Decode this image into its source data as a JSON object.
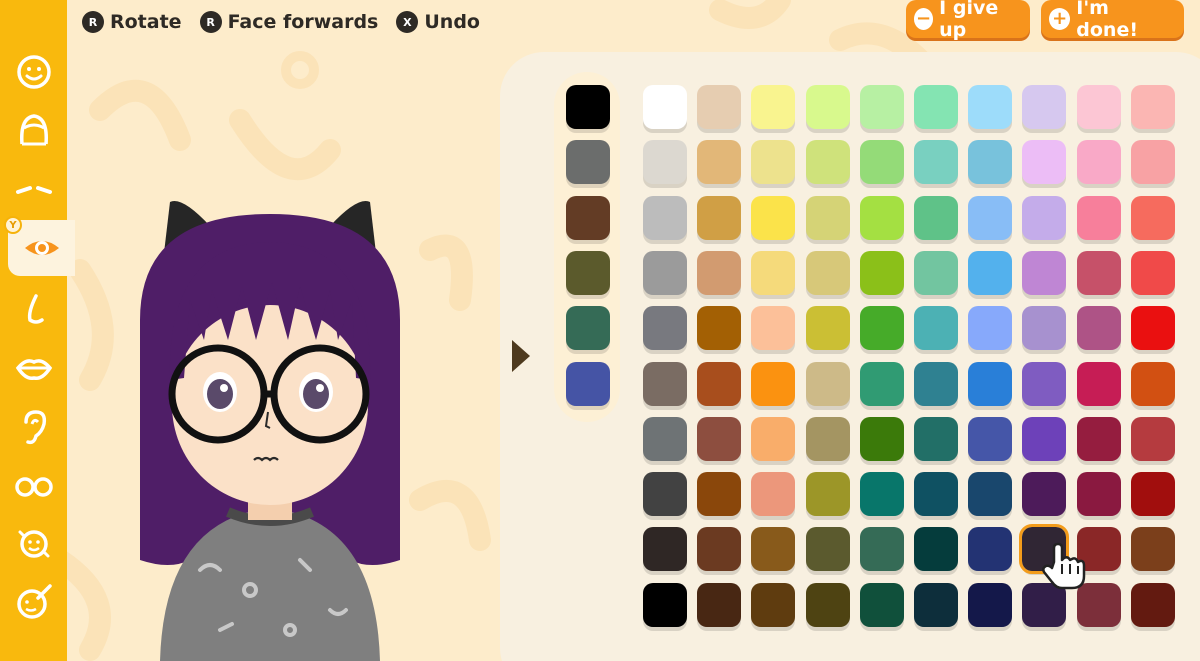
{
  "hints": [
    {
      "glyph": "R",
      "label": "Rotate",
      "icon": "stick-icon"
    },
    {
      "glyph": "R",
      "label": "Face forwards",
      "icon": "stick-press-icon"
    },
    {
      "glyph": "X",
      "label": "Undo",
      "icon": "x-button-icon"
    }
  ],
  "actions": {
    "give_up": {
      "label": "I give up",
      "icon": "minus-icon"
    },
    "done": {
      "label": "I'm done!",
      "icon": "plus-icon"
    }
  },
  "sidebar": {
    "items": [
      {
        "name": "face-shape",
        "icon": "face-icon"
      },
      {
        "name": "hair",
        "icon": "hair-icon"
      },
      {
        "name": "eyebrows",
        "icon": "eyebrows-icon"
      },
      {
        "name": "eyes",
        "icon": "eye-icon",
        "active": true
      },
      {
        "name": "nose",
        "icon": "nose-icon"
      },
      {
        "name": "mouth",
        "icon": "lips-icon"
      },
      {
        "name": "ears",
        "icon": "ear-icon"
      },
      {
        "name": "glasses",
        "icon": "glasses-icon"
      },
      {
        "name": "face-rotate",
        "icon": "face-rotate-icon"
      },
      {
        "name": "makeup",
        "icon": "face-brush-icon"
      }
    ]
  },
  "palette": {
    "base_colors": [
      "#000000",
      "#6b6d6c",
      "#633c25",
      "#5b5a2c",
      "#356b56",
      "#4554a5"
    ],
    "grid": [
      [
        "#ffffff",
        "#e6cdb1",
        "#f9f48f",
        "#d8f98d",
        "#b7f0a3",
        "#84e4b2",
        "#9ddcfa",
        "#d6c8ef",
        "#fcc6d4",
        "#fbb6b3"
      ],
      [
        "#dcd8d0",
        "#e2b778",
        "#ede28d",
        "#cfe27b",
        "#94db78",
        "#79d0c0",
        "#78c2dc",
        "#ecbdf6",
        "#f9a9c7",
        "#f8a2a4"
      ],
      [
        "#bcbcbc",
        "#d09f45",
        "#fbe34a",
        "#d5d376",
        "#a4e042",
        "#5fc288",
        "#88bdf6",
        "#c4acea",
        "#f77f9b",
        "#f66b5e"
      ],
      [
        "#9b9b9b",
        "#d29b70",
        "#f5da7b",
        "#d7c879",
        "#8bc019",
        "#72c5a0",
        "#53b1ed",
        "#bf86d4",
        "#c65169",
        "#f04a49"
      ],
      [
        "#78797f",
        "#a36004",
        "#fcc099",
        "#cbbf34",
        "#46ab29",
        "#4cb1b4",
        "#87a9fb",
        "#a791cf",
        "#ae5386",
        "#ea1010"
      ],
      [
        "#7a6c63",
        "#a84e1d",
        "#fb9210",
        "#cdba88",
        "#309b73",
        "#2f8191",
        "#297fd8",
        "#7f5cc1",
        "#c61d55",
        "#d25012"
      ],
      [
        "#6e7375",
        "#8d4e3f",
        "#f9ad6a",
        "#a49562",
        "#3b7a0a",
        "#226f67",
        "#4556a8",
        "#6d41b9",
        "#951d3f",
        "#b53b3f"
      ],
      [
        "#424242",
        "#8a470b",
        "#ec977b",
        "#9c9628",
        "#08766a",
        "#0f5162",
        "#19476d",
        "#4d1b5a",
        "#8a1940",
        "#a10e0d"
      ],
      [
        "#2f2725",
        "#6b3a21",
        "#885a1b",
        "#5b5a2e",
        "#356b56",
        "#053c3c",
        "#233373",
        "#302634",
        "#8a2727",
        "#7b3f1b"
      ],
      [
        "#000000",
        "#482713",
        "#5f3c0f",
        "#4e4312",
        "#10503b",
        "#0d2e3b",
        "#14184a",
        "#311e48",
        "#7c2f3a",
        "#631a10"
      ]
    ],
    "selected": {
      "row": 8,
      "col": 7
    }
  },
  "character": {
    "hair_color": "#4f1e67",
    "ears_color": "#262626",
    "skin_color": "#fbe1c8",
    "shirt_color": "#7f7f7f",
    "glasses_color": "#111111"
  },
  "colors": {
    "sidebar": "#f9b90d",
    "background": "#fdeccb",
    "panel": "#f8f0e0",
    "accent": "#f7941d"
  }
}
